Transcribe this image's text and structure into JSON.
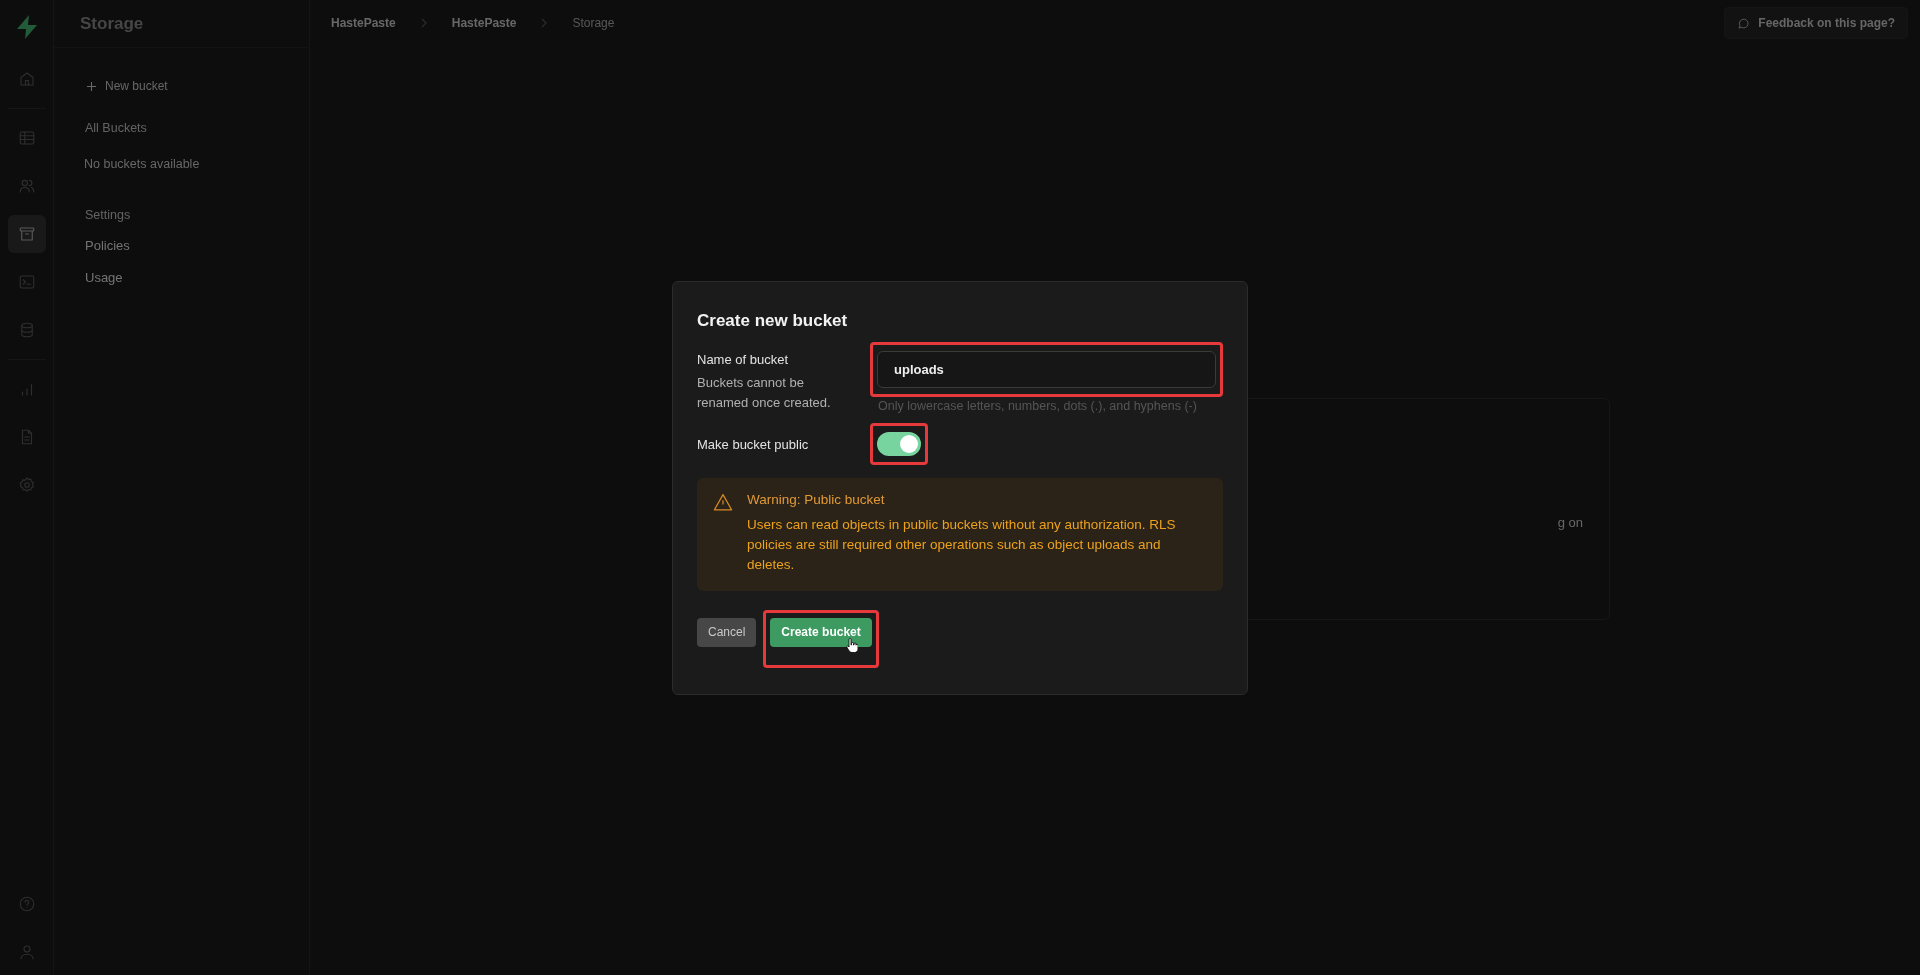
{
  "rail": [
    {
      "kind": "logo"
    },
    {
      "kind": "home",
      "selected": false
    },
    {
      "kind": "divider"
    },
    {
      "kind": "table",
      "selected": false
    },
    {
      "kind": "users",
      "selected": false
    },
    {
      "kind": "storage",
      "selected": true
    },
    {
      "kind": "terminal",
      "selected": false
    },
    {
      "kind": "database",
      "selected": false
    },
    {
      "kind": "divider"
    },
    {
      "kind": "chart",
      "selected": false
    },
    {
      "kind": "document",
      "selected": false
    },
    {
      "kind": "settings",
      "selected": false
    }
  ],
  "rail_bottom": [
    {
      "kind": "help",
      "selected": false
    },
    {
      "kind": "user",
      "selected": false
    }
  ],
  "sidebar": {
    "title": "Storage",
    "items": [
      {
        "kind": "action",
        "label": "New bucket"
      },
      {
        "kind": "heading",
        "label": "All Buckets"
      },
      {
        "kind": "empty",
        "label": "No buckets available"
      },
      {
        "kind": "heading",
        "label": "Settings"
      },
      {
        "kind": "link",
        "label": "Policies"
      },
      {
        "kind": "link",
        "label": "Usage"
      }
    ]
  },
  "breadcrumb": [
    {
      "label": "HastePaste",
      "current": false
    },
    {
      "label": "HastePaste",
      "current": false
    },
    {
      "label": "Storage",
      "current": true
    }
  ],
  "feedback_button": "Feedback on this page?",
  "background_card": {
    "text": "g on"
  },
  "dialog": {
    "title": "Create new bucket",
    "fields": [
      {
        "kind": "text",
        "label": "Name of bucket",
        "description": "Buckets cannot be renamed once created.",
        "value": "uploads",
        "hint": "Only lowercase letters, numbers, dots (.), and hyphens (-)",
        "highlighted": true
      },
      {
        "kind": "toggle",
        "label": "Make bucket public",
        "on": true,
        "highlighted": true
      }
    ],
    "warning": {
      "title": "Warning: Public bucket",
      "text": "Users can read objects in public buckets without any authorization. RLS policies are still required other operations such as object uploads and deletes."
    },
    "buttons": [
      {
        "kind": "secondary",
        "label": "Cancel",
        "highlighted": false
      },
      {
        "kind": "primary",
        "label": "Create bucket",
        "highlighted": true
      }
    ]
  }
}
